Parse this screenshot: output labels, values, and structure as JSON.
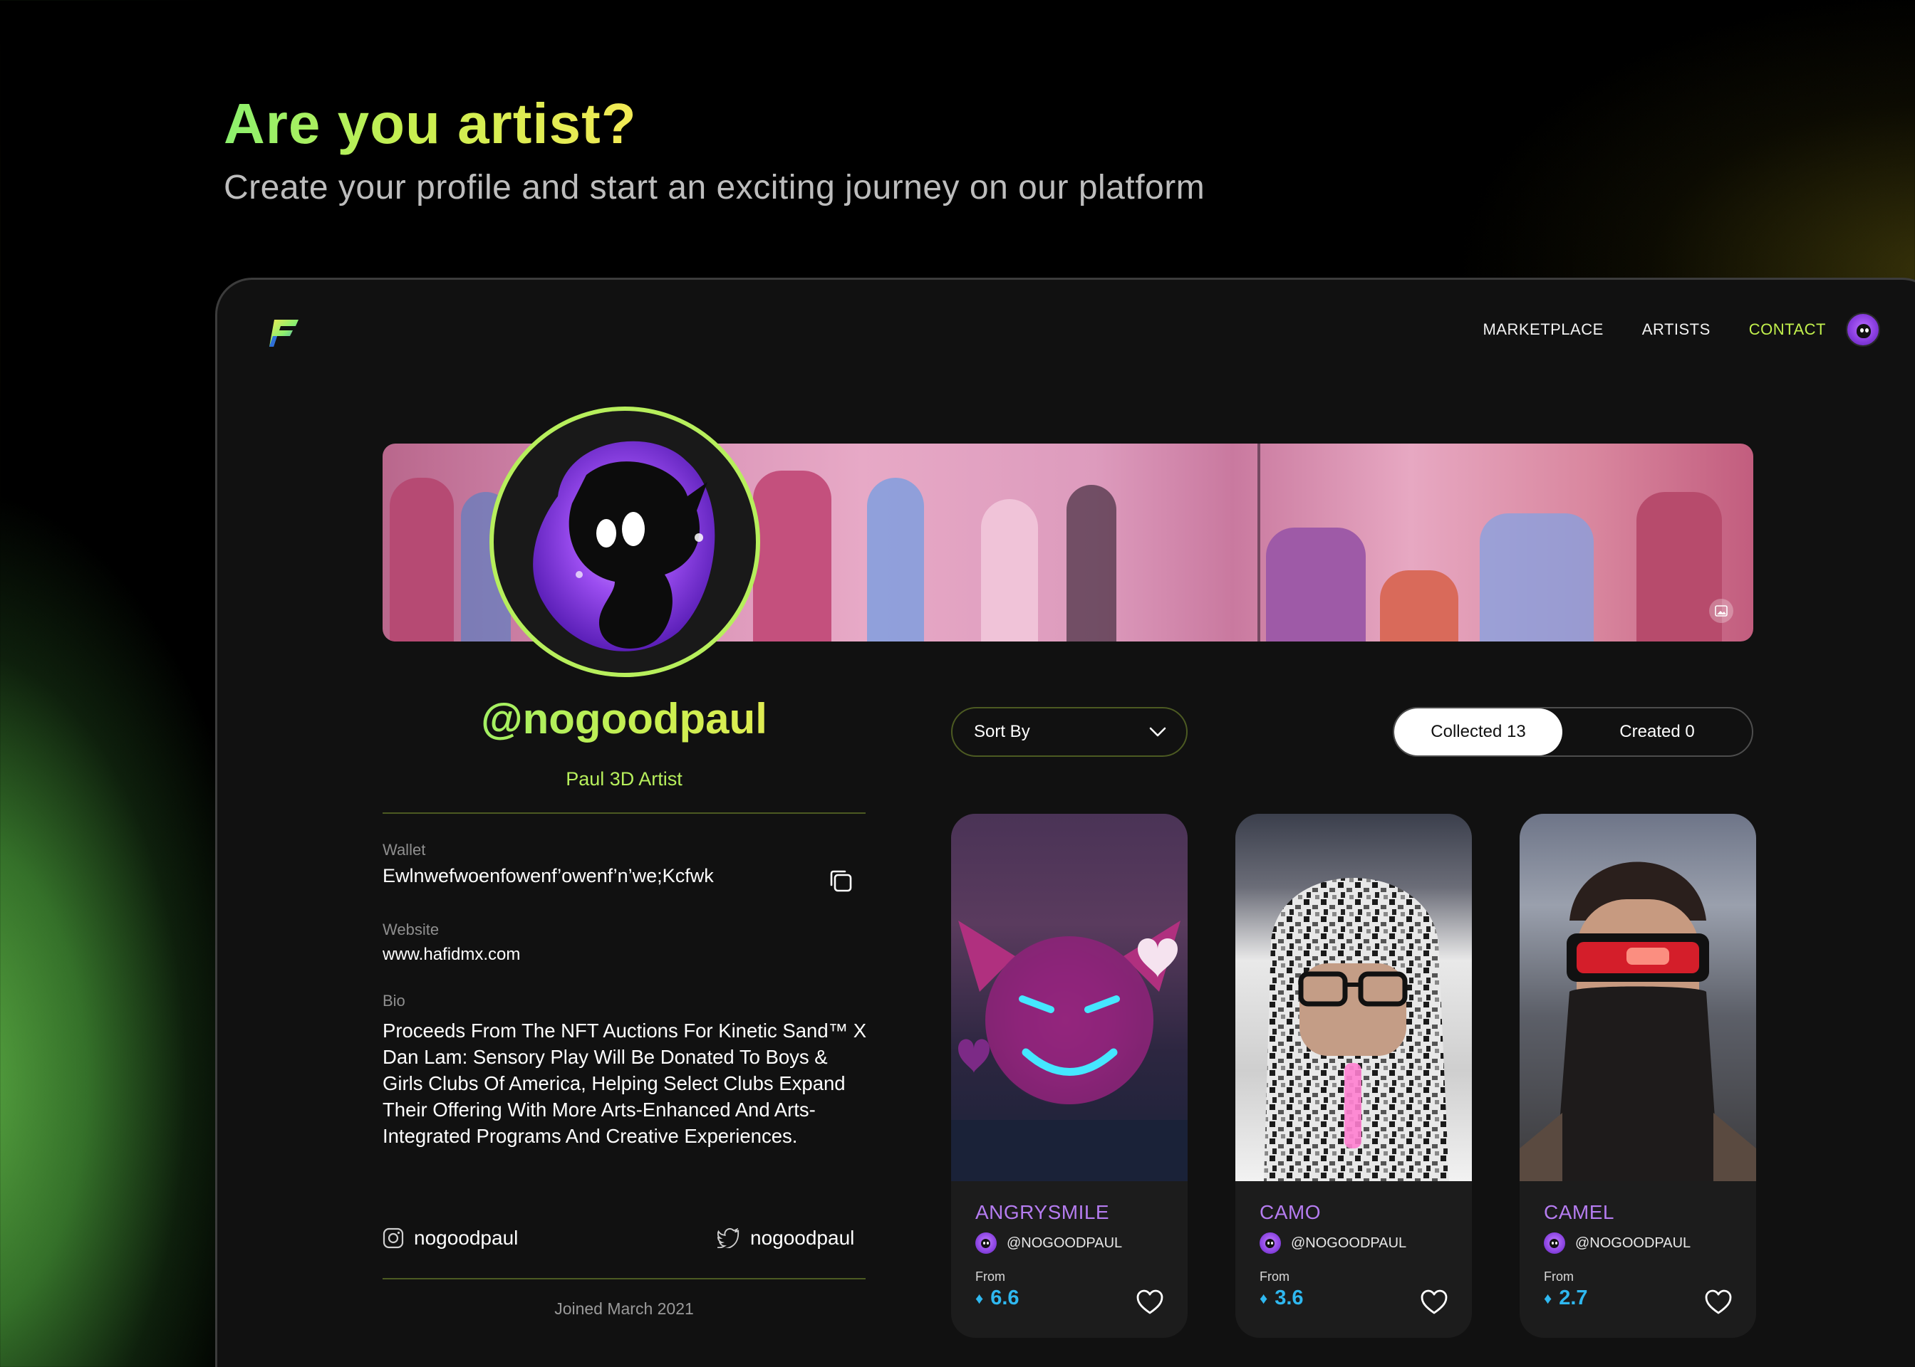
{
  "hero": {
    "title": "Are you artist?",
    "subtitle": "Create your profile and start an exciting journey on our platform"
  },
  "nav": {
    "items": [
      {
        "label": "MARKETPLACE",
        "active": false
      },
      {
        "label": "ARTISTS",
        "active": false
      },
      {
        "label": "CONTACT",
        "active": true
      }
    ]
  },
  "profile": {
    "username": "@nogoodpaul",
    "tagline": "Paul 3D Artist",
    "wallet_label": "Wallet",
    "wallet_value": "Ewlnwefwoenfowenf’owenf’n’we;Kcfwk",
    "website_label": "Website",
    "website_value": "www.hafidmx.com",
    "bio_label": "Bio",
    "bio": "Proceeds From The NFT Auctions For Kinetic Sand™ X Dan Lam: Sensory Play Will Be Donated To Boys & Girls Clubs Of America, Helping Select Clubs Expand Their Offering With More Arts-Enhanced And Arts-Integrated Programs And Creative Experiences.",
    "instagram": "nogoodpaul",
    "twitter": "nogoodpaul",
    "joined": "Joined March 2021"
  },
  "controls": {
    "sort_label": "Sort By",
    "tab_collected": "Collected 13",
    "tab_created": "Created 0"
  },
  "cards": [
    {
      "title": "ANGRYSMILE",
      "creator": "@NOGOODPAUL",
      "from_label": "From",
      "price": "6.6"
    },
    {
      "title": "CAMO",
      "creator": "@NOGOODPAUL",
      "from_label": "From",
      "price": "3.6"
    },
    {
      "title": "CAMEL",
      "creator": "@NOGOODPAUL",
      "from_label": "From",
      "price": "2.7"
    }
  ],
  "icons": {
    "logo": "logo-icon",
    "copy": "copy-icon",
    "instagram": "instagram-icon",
    "twitter": "twitter-icon",
    "chevron": "chevron-down-icon",
    "heart": "heart-icon",
    "eth": "ethereum-icon",
    "banner_edit": "image-edit-icon"
  },
  "colors": {
    "accent_green": "#b7ef5c",
    "accent_yellow": "#f3ea55",
    "card_title_purple": "#b57cf0",
    "price_blue": "#2fb8f0",
    "frame_bg": "#111111"
  }
}
